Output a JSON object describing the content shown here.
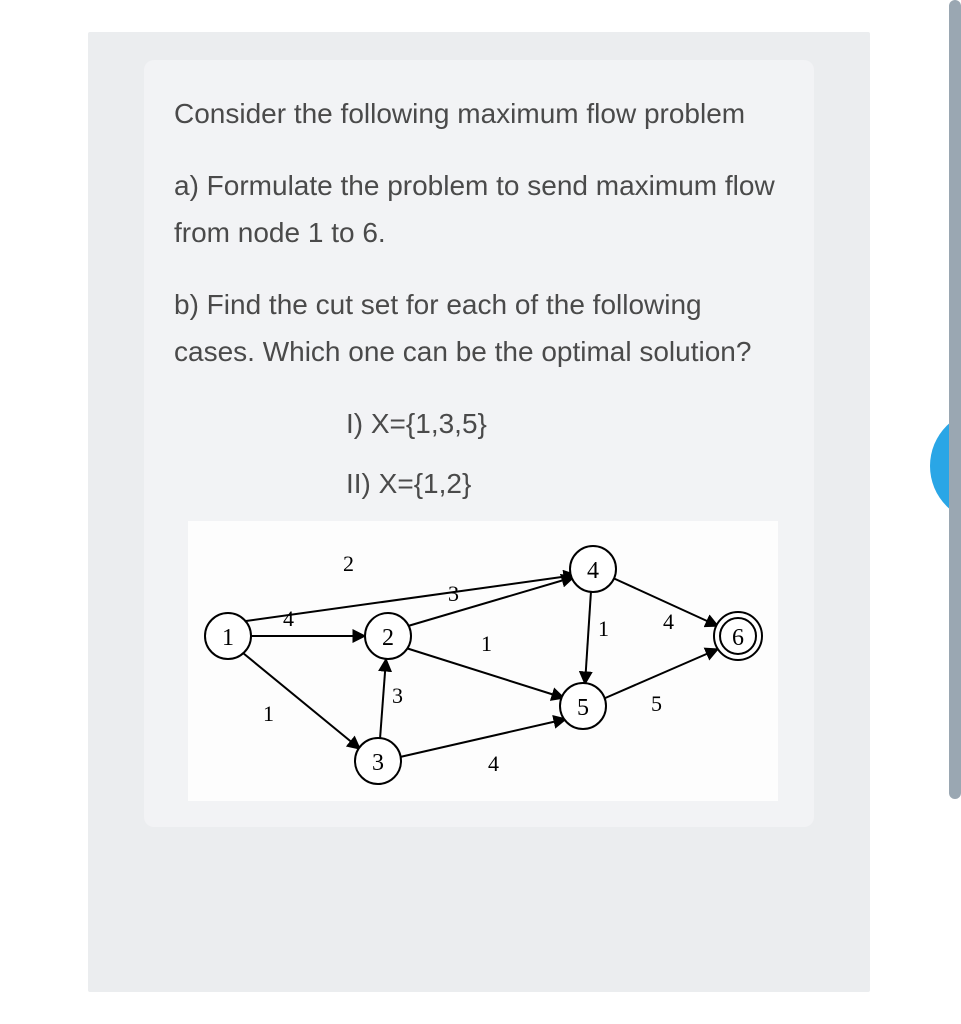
{
  "question": {
    "intro": "Consider the following maximum flow problem",
    "part_a": "a) Formulate the problem to send maximum flow from node 1 to 6.",
    "part_b": " b) Find the cut set for each of the following cases. Which one can be the optimal solution?",
    "case_1": "I)  X={1,3,5}",
    "case_2": "II) X={1,2}"
  },
  "side_button": {
    "name": "collapse-panel",
    "glyph": "chevron-left-icon"
  },
  "chart_data": {
    "type": "graph",
    "title": "",
    "nodes": [
      {
        "id": 1,
        "label": "1"
      },
      {
        "id": 2,
        "label": "2"
      },
      {
        "id": 3,
        "label": "3"
      },
      {
        "id": 4,
        "label": "4"
      },
      {
        "id": 5,
        "label": "5"
      },
      {
        "id": 6,
        "label": "6"
      }
    ],
    "edges": [
      {
        "from": 1,
        "to": 2,
        "capacity": 4
      },
      {
        "from": 1,
        "to": 4,
        "capacity": 2
      },
      {
        "from": 1,
        "to": 3,
        "capacity": 1
      },
      {
        "from": 3,
        "to": 2,
        "capacity": 3
      },
      {
        "from": 2,
        "to": 4,
        "capacity": 3
      },
      {
        "from": 2,
        "to": 5,
        "capacity": 1
      },
      {
        "from": 3,
        "to": 5,
        "capacity": 4
      },
      {
        "from": 4,
        "to": 5,
        "capacity": 1
      },
      {
        "from": 4,
        "to": 6,
        "capacity": 4
      },
      {
        "from": 5,
        "to": 6,
        "capacity": 5
      }
    ],
    "source": 1,
    "sink": 6
  }
}
